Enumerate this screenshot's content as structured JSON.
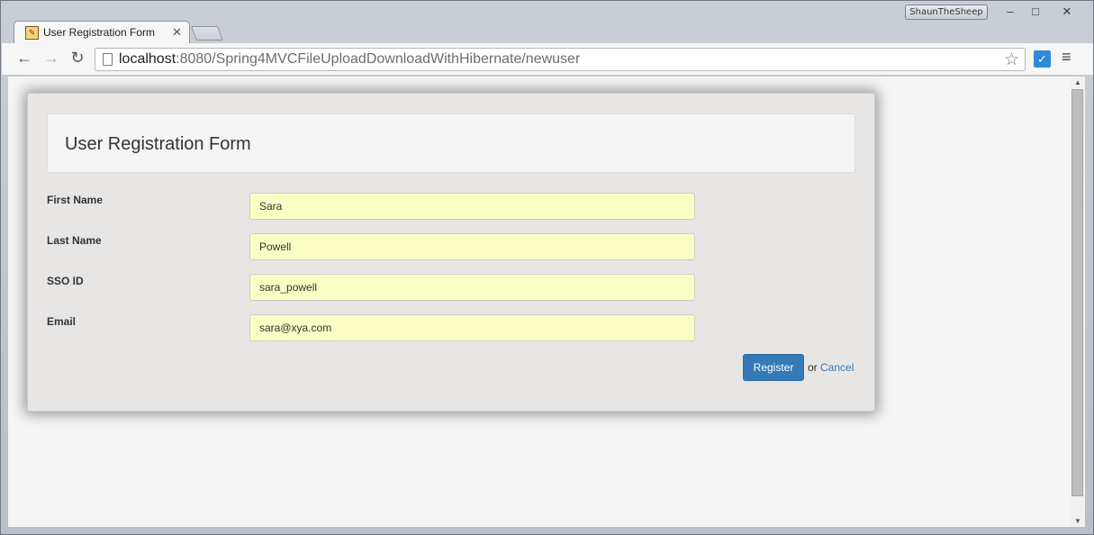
{
  "browser": {
    "profile_name": "ShaunTheSheep",
    "window_controls": {
      "minimize": "–",
      "maximize": "□",
      "close": "✕"
    },
    "tab": {
      "title": "User Registration Form",
      "close": "✕"
    },
    "address": {
      "host": "localhost",
      "rest": ":8080/Spring4MVCFileUploadDownloadWithHibernate/newuser"
    },
    "icons": {
      "back": "back-arrow-icon",
      "forward": "forward-arrow-icon",
      "reload": "reload-icon",
      "star": "bookmark-star-icon",
      "menu": "hamburger-menu-icon"
    }
  },
  "form": {
    "heading": "User Registration Form",
    "fields": [
      {
        "label": "First Name",
        "value": "Sara"
      },
      {
        "label": "Last Name",
        "value": "Powell"
      },
      {
        "label": "SSO ID",
        "value": "sara_powell"
      },
      {
        "label": "Email",
        "value": "sara@xya.com"
      }
    ],
    "register_label": "Register",
    "or_text": "or",
    "cancel_label": "Cancel"
  },
  "colors": {
    "primary_button": "#337ab7",
    "field_autofill_bg": "#fbffc4",
    "panel_bg": "#e8e6e5"
  }
}
